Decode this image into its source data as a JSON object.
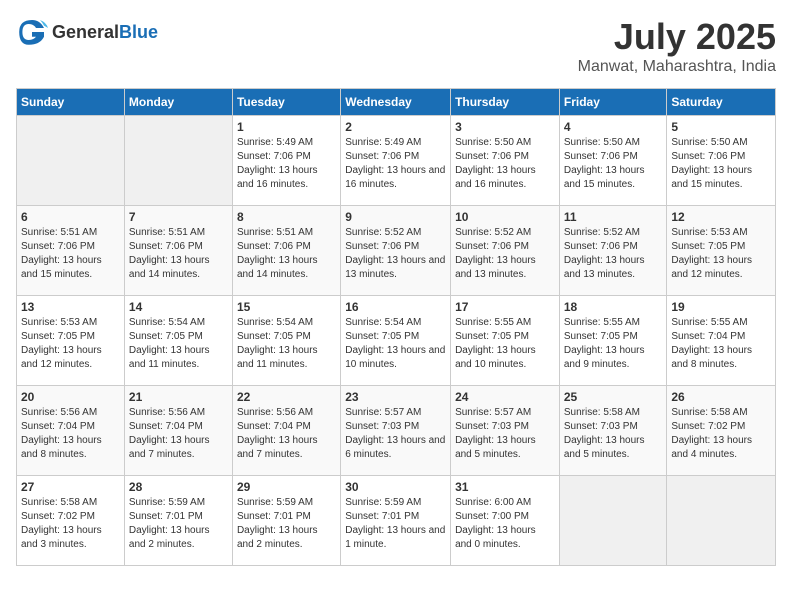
{
  "header": {
    "logo_general": "General",
    "logo_blue": "Blue",
    "month": "July 2025",
    "location": "Manwat, Maharashtra, India"
  },
  "days_of_week": [
    "Sunday",
    "Monday",
    "Tuesday",
    "Wednesday",
    "Thursday",
    "Friday",
    "Saturday"
  ],
  "weeks": [
    [
      {
        "day": "",
        "info": ""
      },
      {
        "day": "",
        "info": ""
      },
      {
        "day": "1",
        "info": "Sunrise: 5:49 AM\nSunset: 7:06 PM\nDaylight: 13 hours\nand 16 minutes."
      },
      {
        "day": "2",
        "info": "Sunrise: 5:49 AM\nSunset: 7:06 PM\nDaylight: 13 hours\nand 16 minutes."
      },
      {
        "day": "3",
        "info": "Sunrise: 5:50 AM\nSunset: 7:06 PM\nDaylight: 13 hours\nand 16 minutes."
      },
      {
        "day": "4",
        "info": "Sunrise: 5:50 AM\nSunset: 7:06 PM\nDaylight: 13 hours\nand 15 minutes."
      },
      {
        "day": "5",
        "info": "Sunrise: 5:50 AM\nSunset: 7:06 PM\nDaylight: 13 hours\nand 15 minutes."
      }
    ],
    [
      {
        "day": "6",
        "info": "Sunrise: 5:51 AM\nSunset: 7:06 PM\nDaylight: 13 hours\nand 15 minutes."
      },
      {
        "day": "7",
        "info": "Sunrise: 5:51 AM\nSunset: 7:06 PM\nDaylight: 13 hours\nand 14 minutes."
      },
      {
        "day": "8",
        "info": "Sunrise: 5:51 AM\nSunset: 7:06 PM\nDaylight: 13 hours\nand 14 minutes."
      },
      {
        "day": "9",
        "info": "Sunrise: 5:52 AM\nSunset: 7:06 PM\nDaylight: 13 hours\nand 13 minutes."
      },
      {
        "day": "10",
        "info": "Sunrise: 5:52 AM\nSunset: 7:06 PM\nDaylight: 13 hours\nand 13 minutes."
      },
      {
        "day": "11",
        "info": "Sunrise: 5:52 AM\nSunset: 7:06 PM\nDaylight: 13 hours\nand 13 minutes."
      },
      {
        "day": "12",
        "info": "Sunrise: 5:53 AM\nSunset: 7:05 PM\nDaylight: 13 hours\nand 12 minutes."
      }
    ],
    [
      {
        "day": "13",
        "info": "Sunrise: 5:53 AM\nSunset: 7:05 PM\nDaylight: 13 hours\nand 12 minutes."
      },
      {
        "day": "14",
        "info": "Sunrise: 5:54 AM\nSunset: 7:05 PM\nDaylight: 13 hours\nand 11 minutes."
      },
      {
        "day": "15",
        "info": "Sunrise: 5:54 AM\nSunset: 7:05 PM\nDaylight: 13 hours\nand 11 minutes."
      },
      {
        "day": "16",
        "info": "Sunrise: 5:54 AM\nSunset: 7:05 PM\nDaylight: 13 hours\nand 10 minutes."
      },
      {
        "day": "17",
        "info": "Sunrise: 5:55 AM\nSunset: 7:05 PM\nDaylight: 13 hours\nand 10 minutes."
      },
      {
        "day": "18",
        "info": "Sunrise: 5:55 AM\nSunset: 7:05 PM\nDaylight: 13 hours\nand 9 minutes."
      },
      {
        "day": "19",
        "info": "Sunrise: 5:55 AM\nSunset: 7:04 PM\nDaylight: 13 hours\nand 8 minutes."
      }
    ],
    [
      {
        "day": "20",
        "info": "Sunrise: 5:56 AM\nSunset: 7:04 PM\nDaylight: 13 hours\nand 8 minutes."
      },
      {
        "day": "21",
        "info": "Sunrise: 5:56 AM\nSunset: 7:04 PM\nDaylight: 13 hours\nand 7 minutes."
      },
      {
        "day": "22",
        "info": "Sunrise: 5:56 AM\nSunset: 7:04 PM\nDaylight: 13 hours\nand 7 minutes."
      },
      {
        "day": "23",
        "info": "Sunrise: 5:57 AM\nSunset: 7:03 PM\nDaylight: 13 hours\nand 6 minutes."
      },
      {
        "day": "24",
        "info": "Sunrise: 5:57 AM\nSunset: 7:03 PM\nDaylight: 13 hours\nand 5 minutes."
      },
      {
        "day": "25",
        "info": "Sunrise: 5:58 AM\nSunset: 7:03 PM\nDaylight: 13 hours\nand 5 minutes."
      },
      {
        "day": "26",
        "info": "Sunrise: 5:58 AM\nSunset: 7:02 PM\nDaylight: 13 hours\nand 4 minutes."
      }
    ],
    [
      {
        "day": "27",
        "info": "Sunrise: 5:58 AM\nSunset: 7:02 PM\nDaylight: 13 hours\nand 3 minutes."
      },
      {
        "day": "28",
        "info": "Sunrise: 5:59 AM\nSunset: 7:01 PM\nDaylight: 13 hours\nand 2 minutes."
      },
      {
        "day": "29",
        "info": "Sunrise: 5:59 AM\nSunset: 7:01 PM\nDaylight: 13 hours\nand 2 minutes."
      },
      {
        "day": "30",
        "info": "Sunrise: 5:59 AM\nSunset: 7:01 PM\nDaylight: 13 hours\nand 1 minute."
      },
      {
        "day": "31",
        "info": "Sunrise: 6:00 AM\nSunset: 7:00 PM\nDaylight: 13 hours\nand 0 minutes."
      },
      {
        "day": "",
        "info": ""
      },
      {
        "day": "",
        "info": ""
      }
    ]
  ]
}
